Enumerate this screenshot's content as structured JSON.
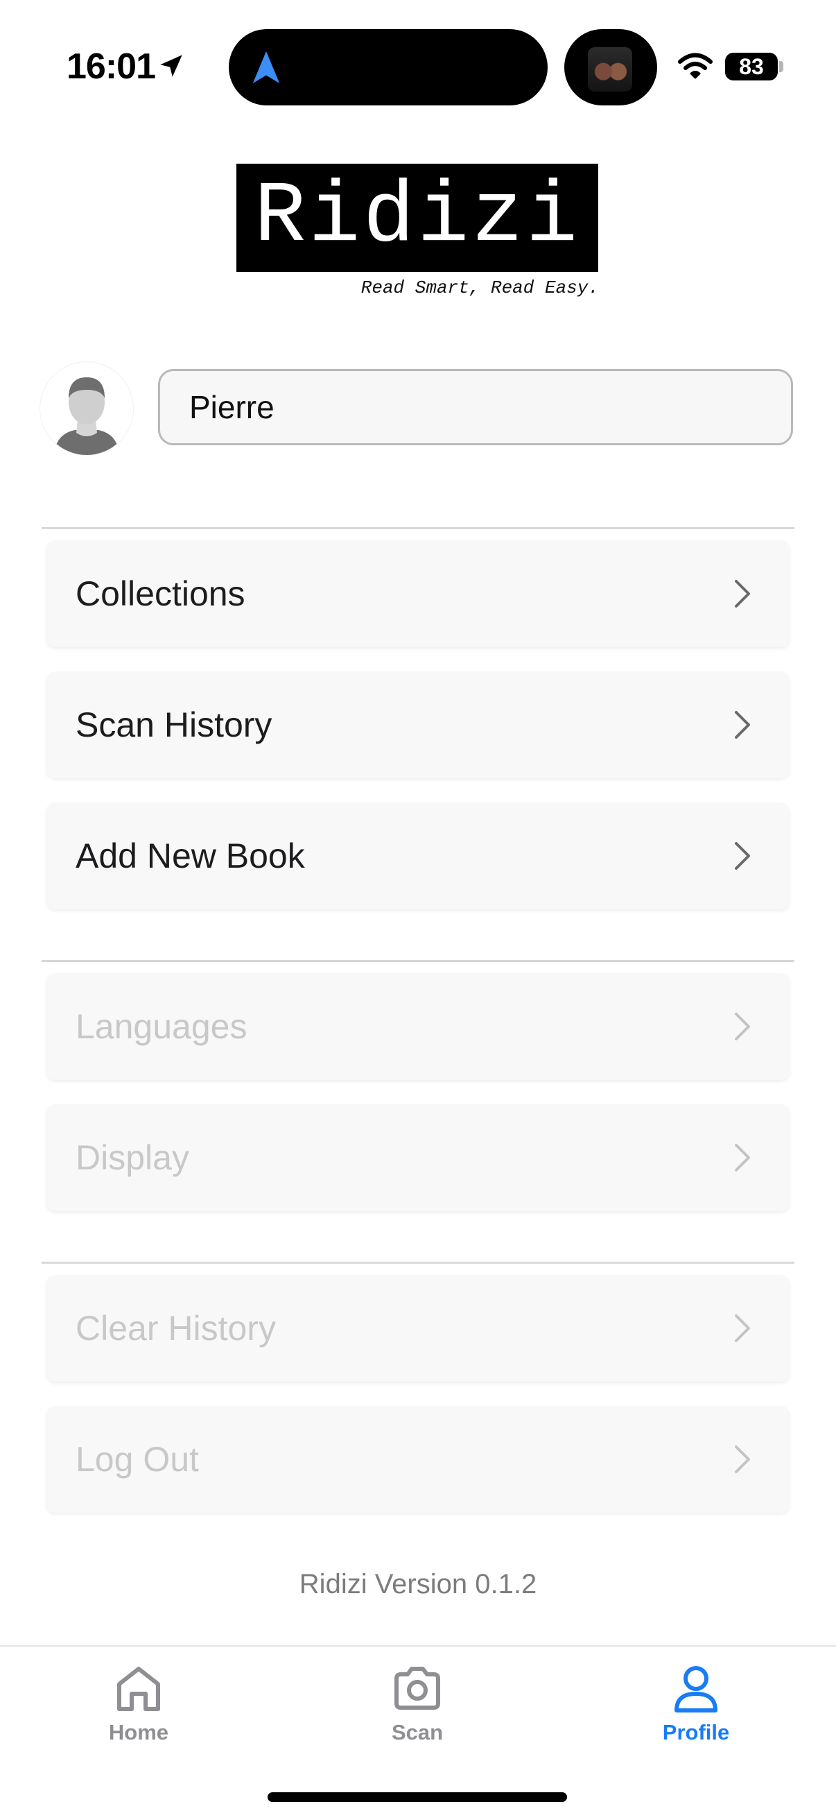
{
  "status_bar": {
    "time": "16:01",
    "battery": "83"
  },
  "logo": {
    "title": "Ridizi",
    "tagline": "Read Smart, Read Easy."
  },
  "profile": {
    "name_value": "Pierre"
  },
  "menu": {
    "group1": [
      {
        "label": "Collections",
        "enabled": true
      },
      {
        "label": "Scan History",
        "enabled": true
      },
      {
        "label": "Add New Book",
        "enabled": true
      }
    ],
    "group2": [
      {
        "label": "Languages",
        "enabled": false
      },
      {
        "label": "Display",
        "enabled": false
      }
    ],
    "group3": [
      {
        "label": "Clear History",
        "enabled": false
      },
      {
        "label": "Log Out",
        "enabled": false
      }
    ]
  },
  "version": "Ridizi Version 0.1.2",
  "tabs": [
    {
      "label": "Home",
      "icon": "home-icon",
      "active": false
    },
    {
      "label": "Scan",
      "icon": "camera-icon",
      "active": false
    },
    {
      "label": "Profile",
      "icon": "person-icon",
      "active": true
    }
  ],
  "colors": {
    "accent": "#1a7cf5",
    "inactive_tab": "#8e8e93",
    "disabled_text": "#c8c8c8",
    "row_background": "#f8f8f8"
  }
}
